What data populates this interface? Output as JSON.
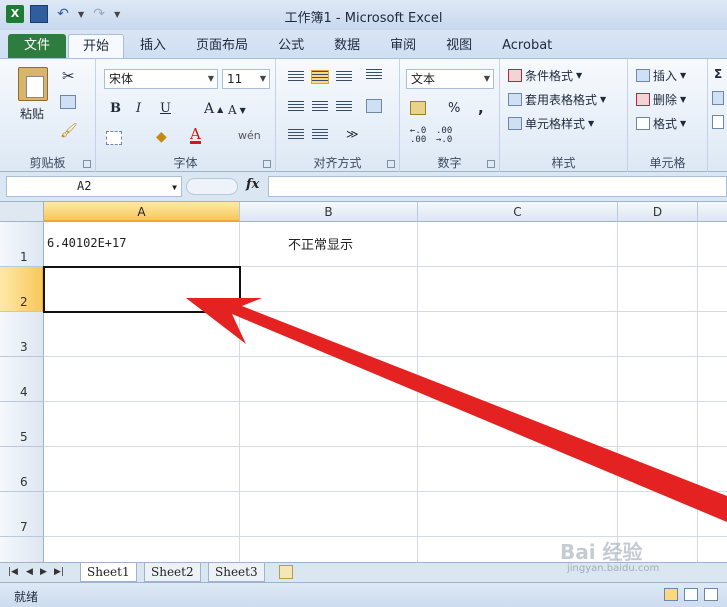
{
  "window": {
    "title": "工作簿1 - Microsoft Excel"
  },
  "tabs": [
    {
      "label": "文件"
    },
    {
      "label": "开始"
    },
    {
      "label": "插入"
    },
    {
      "label": "页面布局"
    },
    {
      "label": "公式"
    },
    {
      "label": "数据"
    },
    {
      "label": "审阅"
    },
    {
      "label": "视图"
    },
    {
      "label": "Acrobat"
    }
  ],
  "ribbon": {
    "clipboard": {
      "label": "剪贴板",
      "paste": "粘贴"
    },
    "font": {
      "label": "字体",
      "name": "宋体",
      "size": "11",
      "bold": "B",
      "italic": "I",
      "underline": "U"
    },
    "alignment": {
      "label": "对齐方式"
    },
    "number": {
      "label": "数字",
      "format": "文本",
      "percent": "%",
      "comma": ","
    },
    "styles": {
      "label": "样式",
      "conditional": "条件格式",
      "table": "套用表格格式",
      "cell": "单元格样式"
    },
    "cells": {
      "label": "单元格",
      "insert": "插入",
      "delete": "删除",
      "format": "格式"
    }
  },
  "formula_bar": {
    "name_box": "A2",
    "fx": "fx",
    "content": ""
  },
  "grid": {
    "columns": [
      "A",
      "B",
      "C",
      "D"
    ],
    "rows": [
      "1",
      "2",
      "3",
      "4",
      "5",
      "6",
      "7"
    ],
    "cells": {
      "A1": "6.40102E+17",
      "B1": "不正常显示",
      "A2": ""
    },
    "selected": "A2"
  },
  "sheets": [
    "Sheet1",
    "Sheet2",
    "Sheet3"
  ],
  "status": {
    "text": "就绪"
  },
  "watermark": {
    "brand": "Bai 经验",
    "url": "jingyan.baidu.com"
  },
  "colors": {
    "file_tab": "#2d7d3f",
    "selection_header": "#f7c85b",
    "annotation_arrow": "#e52222"
  }
}
